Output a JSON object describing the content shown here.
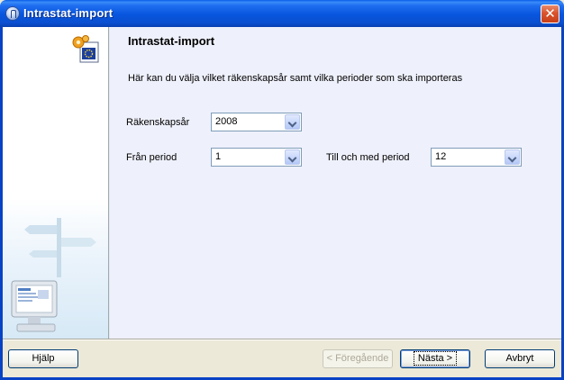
{
  "window": {
    "title": "Intrastat-import"
  },
  "content": {
    "title": "Intrastat-import",
    "description": "Här kan du välja vilket räkenskapsår samt vilka perioder som ska importeras"
  },
  "fields": {
    "fiscal_year": {
      "label": "Räkenskapsår",
      "value": "2008"
    },
    "from_period": {
      "label": "Från period",
      "value": "1"
    },
    "to_period": {
      "label": "Till och med period",
      "value": "12"
    }
  },
  "buttons": {
    "help": "Hjälp",
    "previous": "< Föregående",
    "next": "Nästa >",
    "cancel": "Avbryt"
  },
  "colors": {
    "titlebar": "#0855dd",
    "content_bg": "#eef0fb",
    "close": "#d9542e"
  }
}
